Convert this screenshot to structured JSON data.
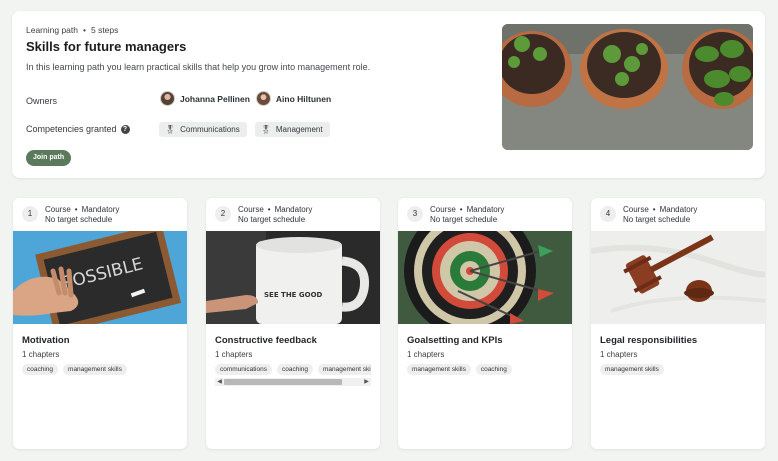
{
  "path": {
    "type": "Learning path",
    "steps": "5 steps",
    "title": "Skills for future managers",
    "description": "In this learning path you learn practical skills that help you grow into management role.",
    "owners_label": "Owners",
    "owners": [
      "Johanna Pellinen",
      "Aino Hiltunen"
    ],
    "competencies_label": "Competencies granted",
    "competencies": [
      "Communications",
      "Management"
    ],
    "join_label": "Join path",
    "help_icon": "?"
  },
  "courses": [
    {
      "num": "1",
      "kind": "Course",
      "status": "Mandatory",
      "schedule": "No target schedule",
      "title": "Motivation",
      "chapters": "1 chapters",
      "tags": [
        "coaching",
        "management skills"
      ],
      "image_text": "POSSIBLE"
    },
    {
      "num": "2",
      "kind": "Course",
      "status": "Mandatory",
      "schedule": "No target schedule",
      "title": "Constructive feedback",
      "chapters": "1 chapters",
      "tags": [
        "communications",
        "coaching",
        "management skills"
      ],
      "image_text": "SEE THE GOOD"
    },
    {
      "num": "3",
      "kind": "Course",
      "status": "Mandatory",
      "schedule": "No target schedule",
      "title": "Goalsetting and KPIs",
      "chapters": "1 chapters",
      "tags": [
        "management skills",
        "coaching"
      ]
    },
    {
      "num": "4",
      "kind": "Course",
      "status": "Mandatory",
      "schedule": "No target schedule",
      "title": "Legal responsibilities",
      "chapters": "1 chapters",
      "tags": [
        "management skills"
      ]
    }
  ],
  "icons": {
    "medal": "medal-icon",
    "help": "help-icon"
  },
  "colors": {
    "join_button": "#5b7a5c",
    "background": "#f2f4f2"
  }
}
